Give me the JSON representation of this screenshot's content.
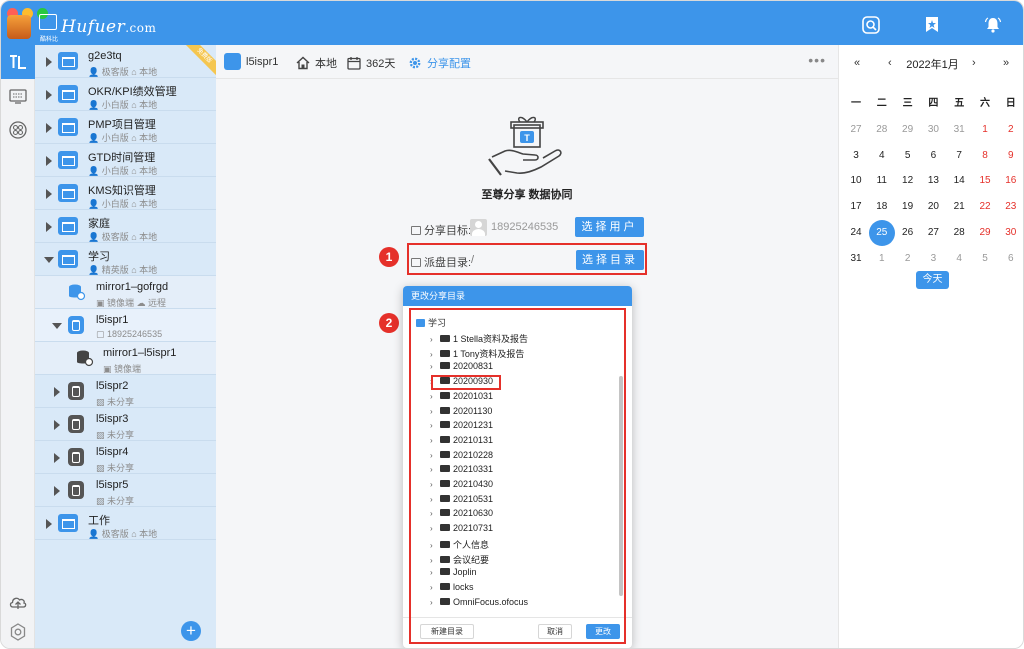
{
  "header": {
    "logo_small": "酷科比",
    "logo_text": "Hufuer",
    "logo_domain": ".com",
    "icons": [
      "search-icon",
      "pin-icon",
      "bell-icon"
    ],
    "accent": "#3d95ea"
  },
  "rail": {
    "items": [
      "logo-icon",
      "keyboard-icon",
      "grid-icon",
      "cloud-upload-icon",
      "settings-icon"
    ]
  },
  "tree": {
    "nodes": [
      {
        "title": "g2e3tq",
        "meta1": "极客版",
        "meta2": "本地",
        "ribbon": "免费版"
      },
      {
        "title": "OKR/KPI绩效管理",
        "meta1": "小白版",
        "meta2": "本地"
      },
      {
        "title": "PMP项目管理",
        "meta1": "小白版",
        "meta2": "本地"
      },
      {
        "title": "GTD时间管理",
        "meta1": "小白版",
        "meta2": "本地"
      },
      {
        "title": "KMS知识管理",
        "meta1": "小白版",
        "meta2": "本地"
      },
      {
        "title": "家庭",
        "meta1": "极客版",
        "meta2": "本地"
      },
      {
        "title": "学习",
        "meta1": "精英版",
        "meta2": "本地"
      },
      {
        "title": "mirror1–gofrgd",
        "meta1": "镜像端",
        "meta2": "远程"
      },
      {
        "title": "l5ispr1",
        "meta1": "18925246535"
      },
      {
        "title": "mirror1–l5ispr1",
        "meta1": "镜像端"
      },
      {
        "title": "l5ispr2",
        "meta1": "未分享"
      },
      {
        "title": "l5ispr3",
        "meta1": "未分享"
      },
      {
        "title": "l5ispr4",
        "meta1": "未分享"
      },
      {
        "title": "l5ispr5",
        "meta1": "未分享"
      },
      {
        "title": "工作",
        "meta1": "极客版",
        "meta2": "本地"
      }
    ],
    "add_label": "+"
  },
  "toolbar": {
    "name": "l5ispr1",
    "location": "本地",
    "days": "362天",
    "share_config": "分享配置",
    "more": "•••"
  },
  "main": {
    "hero_text": "至尊分享 数据协同",
    "share_target_label": "分享目标:",
    "share_target_value": "18925246535",
    "select_user_btn": "选择用户",
    "dir_label": "派盘目录:",
    "dir_value": "/",
    "select_dir_btn": "选择目录",
    "badge1": "1",
    "badge2": "2"
  },
  "dialog": {
    "title": "更改分享目录",
    "root": "学习",
    "items": [
      "1 Stella资料及报告",
      "1 Tony资料及报告",
      "20200831",
      "20200930",
      "20201031",
      "20201130",
      "20201231",
      "20210131",
      "20210228",
      "20210331",
      "20210430",
      "20210531",
      "20210630",
      "20210731",
      "个人信息",
      "会议纪要",
      "Joplin",
      "locks",
      "OmniFocus.ofocus"
    ],
    "highlighted": "20200930",
    "new_dir_btn": "新建目录",
    "cancel_btn": "取消",
    "confirm_btn": "更改"
  },
  "calendar": {
    "title": "2022年1月",
    "nav": [
      "«",
      "‹",
      "›",
      "»"
    ],
    "weekdays": [
      "一",
      "二",
      "三",
      "四",
      "五",
      "六",
      "日"
    ],
    "weeks": [
      [
        "27",
        "28",
        "29",
        "30",
        "31",
        "1",
        "2"
      ],
      [
        "3",
        "4",
        "5",
        "6",
        "7",
        "8",
        "9"
      ],
      [
        "10",
        "11",
        "12",
        "13",
        "14",
        "15",
        "16"
      ],
      [
        "17",
        "18",
        "19",
        "20",
        "21",
        "22",
        "23"
      ],
      [
        "24",
        "25",
        "26",
        "27",
        "28",
        "29",
        "30"
      ],
      [
        "31",
        "1",
        "2",
        "3",
        "4",
        "5",
        "6"
      ]
    ],
    "today_btn": "今天",
    "selected_day": "25",
    "weekend_color": "#e5302a"
  }
}
